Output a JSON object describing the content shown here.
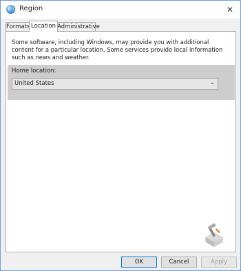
{
  "window": {
    "title": "Region",
    "close_glyph": "✕",
    "accent_color": "#0078d7",
    "border_color": "#6f9fd4"
  },
  "tabs": [
    {
      "label": "Formats",
      "active": false
    },
    {
      "label": "Location",
      "active": true
    },
    {
      "label": "Administrative",
      "active": false
    }
  ],
  "location": {
    "description": "Some software, including Windows, may provide you with additional content for a particular location. Some services provide local information such as news and weather.",
    "home_label": "Home location:",
    "home_value": "United States"
  },
  "buttons": {
    "ok": "OK",
    "cancel": "Cancel",
    "apply": "Apply"
  },
  "icons": {
    "app": "globe-icon",
    "close": "close-icon",
    "dropdown": "chevron-down-icon",
    "watermark": "tools-logo"
  }
}
